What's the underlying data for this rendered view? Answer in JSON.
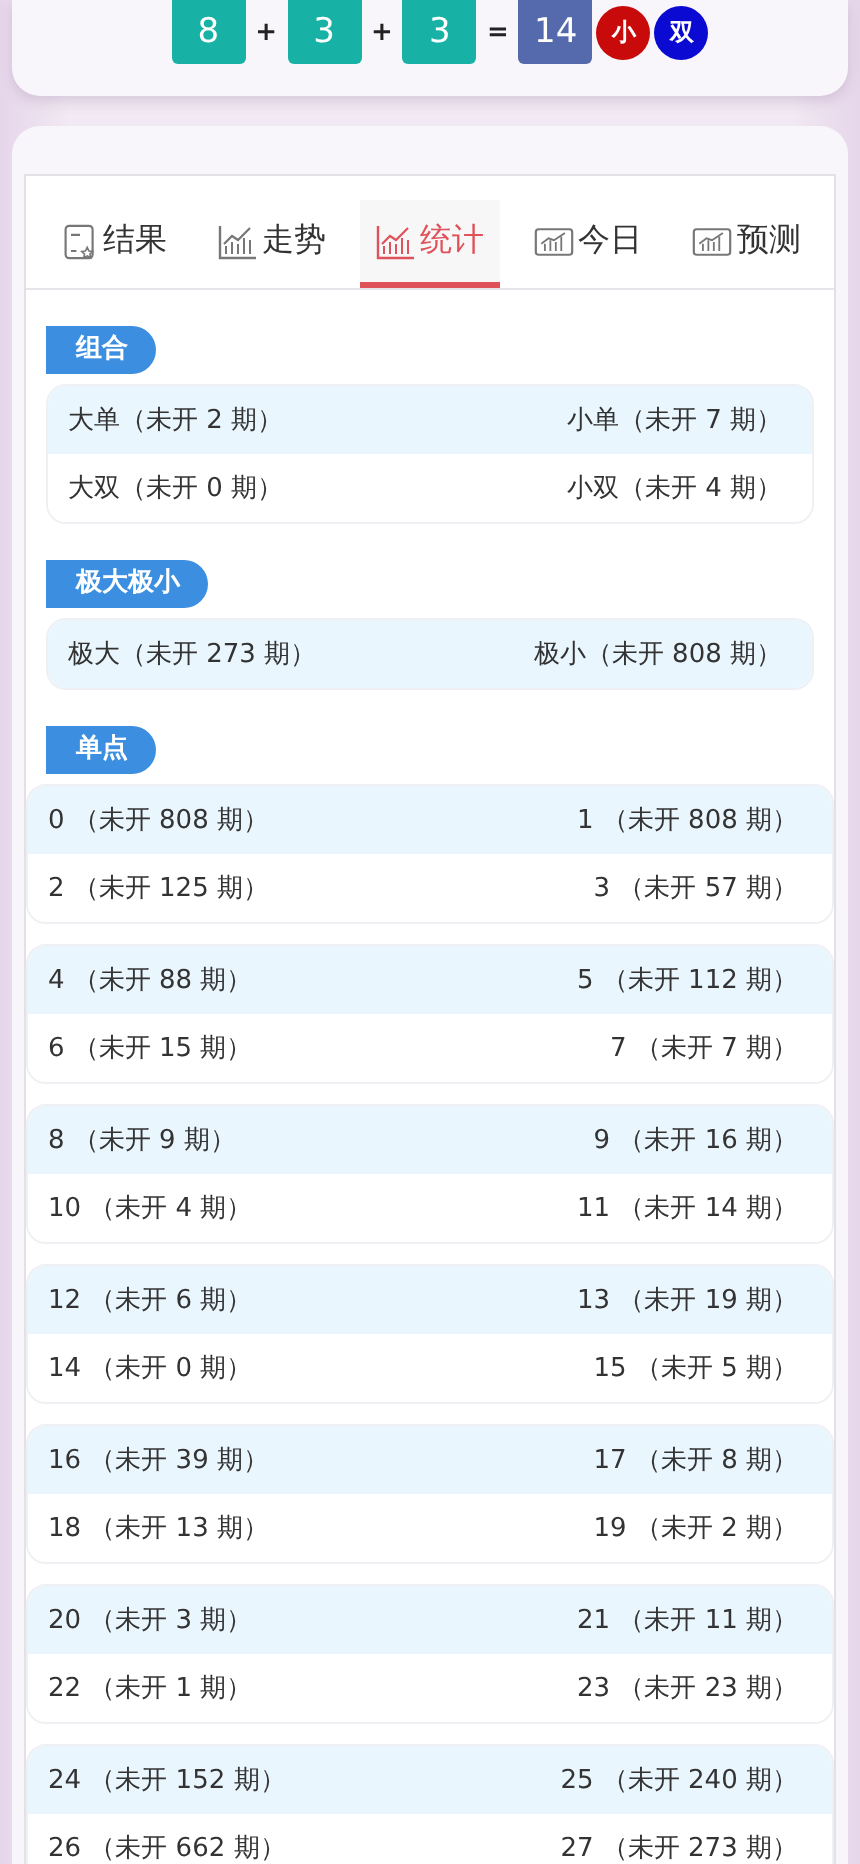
{
  "draw": {
    "numbers": [
      "8",
      "3",
      "3"
    ],
    "operators": [
      "+",
      "+",
      "="
    ],
    "sum": "14",
    "tags": [
      {
        "label": "小",
        "color": "#c80a0a"
      },
      {
        "label": "双",
        "color": "#0a0ad2"
      }
    ]
  },
  "tabs": [
    {
      "label": "结果",
      "kind": "document",
      "selected": false
    },
    {
      "label": "走势",
      "kind": "chart",
      "selected": false
    },
    {
      "label": "统计",
      "kind": "chart",
      "selected": true
    },
    {
      "label": "今日",
      "kind": "boxed",
      "selected": false
    },
    {
      "label": "预测",
      "kind": "boxed",
      "selected": false
    }
  ],
  "sections": [
    {
      "title": "组合",
      "kind": "inset",
      "groups": [
        {
          "rows": [
            {
              "left": "大单（未开 2 期）",
              "right": "小单（未开 7 期）"
            },
            {
              "left": "大双（未开 0 期）",
              "right": "小双（未开 4 期）"
            }
          ]
        }
      ]
    },
    {
      "title": "极大极小",
      "kind": "inset",
      "groups": [
        {
          "rows": [
            {
              "left": "极大（未开 273 期）",
              "right": "极小（未开 808 期）"
            }
          ]
        }
      ]
    },
    {
      "title": "单点",
      "kind": "wide",
      "groups": [
        {
          "rows": [
            {
              "left": "0 （未开 808 期）",
              "right": "1 （未开 808 期）"
            },
            {
              "left": "2 （未开 125 期）",
              "right": "3 （未开 57 期）"
            }
          ]
        },
        {
          "rows": [
            {
              "left": "4 （未开 88 期）",
              "right": "5 （未开 112 期）"
            },
            {
              "left": "6 （未开 15 期）",
              "right": "7 （未开 7 期）"
            }
          ]
        },
        {
          "rows": [
            {
              "left": "8 （未开 9 期）",
              "right": "9 （未开 16 期）"
            },
            {
              "left": "10 （未开 4 期）",
              "right": "11 （未开 14 期）"
            }
          ]
        },
        {
          "rows": [
            {
              "left": "12 （未开 6 期）",
              "right": "13 （未开 19 期）"
            },
            {
              "left": "14 （未开 0 期）",
              "right": "15 （未开 5 期）"
            }
          ]
        },
        {
          "rows": [
            {
              "left": "16 （未开 39 期）",
              "right": "17 （未开 8 期）"
            },
            {
              "left": "18 （未开 13 期）",
              "right": "19 （未开 2 期）"
            }
          ]
        },
        {
          "rows": [
            {
              "left": "20 （未开 3 期）",
              "right": "21 （未开 11 期）"
            },
            {
              "left": "22 （未开 1 期）",
              "right": "23 （未开 23 期）"
            }
          ]
        },
        {
          "rows": [
            {
              "left": "24 （未开 152 期）",
              "right": "25 （未开 240 期）"
            },
            {
              "left": "26 （未开 662 期）",
              "right": "27 （未开 273 期）"
            }
          ]
        }
      ]
    }
  ]
}
